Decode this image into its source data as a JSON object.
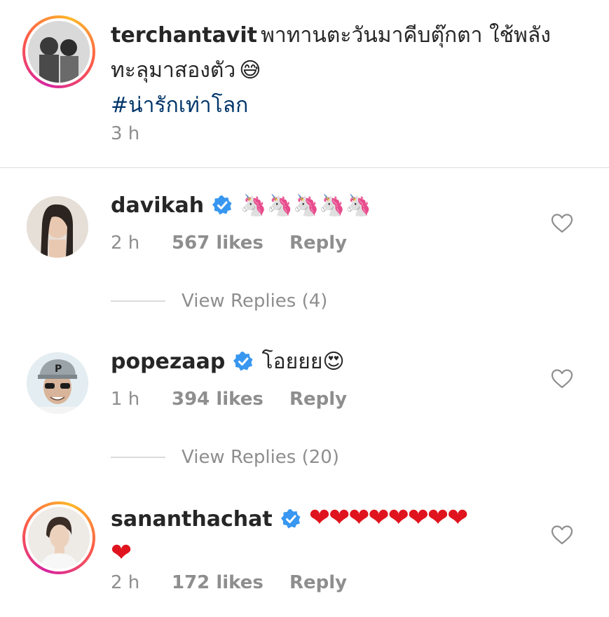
{
  "caption": {
    "username": "terchantavit",
    "text_line1": "พาทานตะวันมาคีบตุ๊กตา ใช้พลัง",
    "text_line2": "ทะลุมาสองตัว",
    "hashtag": "#น่ารักเท่าโลก",
    "time": "3 h",
    "emoji": "😅"
  },
  "comments": [
    {
      "username": "davikah",
      "verified": true,
      "text": "🦄🦄🦄🦄🦄",
      "time": "2 h",
      "likes": "567 likes",
      "reply": "Reply",
      "view_replies": "View Replies (4)"
    },
    {
      "username": "popezaap",
      "verified": true,
      "text": "โอยยย😍",
      "time": "1 h",
      "likes": "394 likes",
      "reply": "Reply",
      "view_replies": "View Replies (20)"
    },
    {
      "username": "sananthachat",
      "verified": true,
      "text_line1": "❤❤❤❤❤❤❤❤",
      "text_line2": "❤",
      "time": "2 h",
      "likes": "172 likes",
      "reply": "Reply"
    }
  ],
  "colors": {
    "verified_blue": "#3897f0",
    "hashtag": "#003569",
    "meta": "#8e8e8e",
    "heart": "#e0141e"
  }
}
